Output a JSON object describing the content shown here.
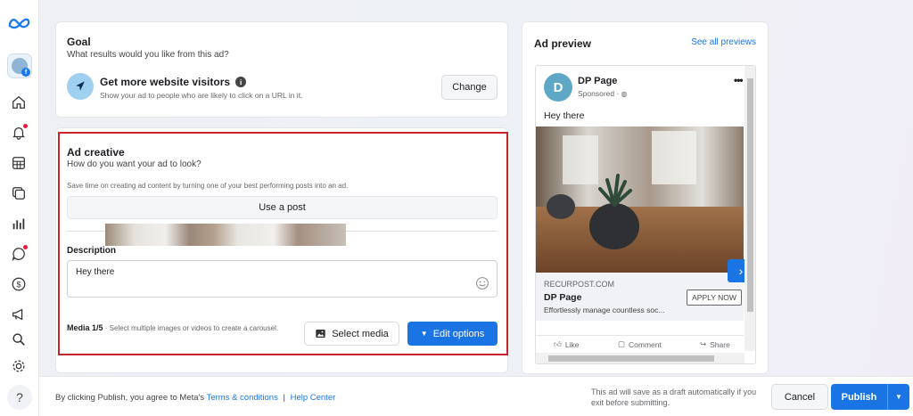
{
  "nav": {
    "items": [
      {
        "name": "home-icon"
      },
      {
        "name": "bell-icon"
      },
      {
        "name": "table-icon"
      },
      {
        "name": "layers-icon"
      },
      {
        "name": "bar-chart-icon"
      },
      {
        "name": "chat-icon"
      },
      {
        "name": "dollar-icon"
      },
      {
        "name": "megaphone-icon"
      },
      {
        "name": "search-icon"
      },
      {
        "name": "gear-icon"
      }
    ],
    "help": "?"
  },
  "goal": {
    "title": "Goal",
    "subtitle": "What results would you like from this ad?",
    "option_title": "Get more website visitors",
    "option_subtitle": "Show your ad to people who are likely to click on a URL in it.",
    "change_label": "Change"
  },
  "creative": {
    "title": "Ad creative",
    "subtitle": "How do you want your ad to look?",
    "hint": "Save time on creating ad content by turning one of your best performing posts into an ad.",
    "use_post_label": "Use a post",
    "description_label": "Description",
    "description_value": "Hey there",
    "media_label": "Media 1/5",
    "media_hint": "· Select multiple images or videos to create a carousel.",
    "select_media_label": "Select media",
    "edit_options_label": "Edit options"
  },
  "preview": {
    "title": "Ad preview",
    "see_all": "See all previews",
    "avatar_letter": "D",
    "page_name": "DP Page",
    "sponsored": "Sponsored · ",
    "more": "•••",
    "post_text": "Hey there",
    "domain": "RECURPOST.COM",
    "headline": "DP Page",
    "link_desc": "Effortlessly manage countless soc...",
    "cta": "APPLY NOW",
    "like": "Like",
    "comment": "Comment",
    "share": "Share"
  },
  "footer": {
    "text": "By clicking Publish, you agree to Meta's",
    "terms": "Terms & conditions",
    "sep": "|",
    "help_center": "Help Center",
    "draft_note": "This ad will save as a draft automatically if you exit before submitting.",
    "cancel": "Cancel",
    "publish": "Publish"
  },
  "colors": {
    "accent": "#1b74e4",
    "highlight_outline": "#c8242b"
  }
}
